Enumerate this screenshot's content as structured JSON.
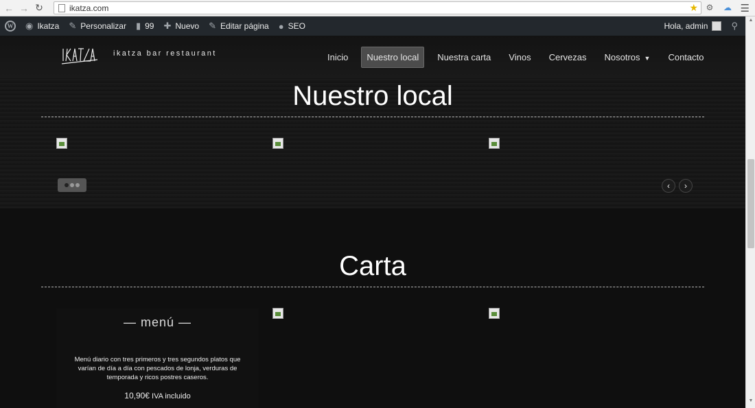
{
  "browser": {
    "url": "ikatza.com",
    "back_icon": "arrow-left-icon",
    "forward_icon": "arrow-right-icon",
    "reload_icon": "reload-icon"
  },
  "adminbar": {
    "site_name": "Ikatza",
    "customize": "Personalizar",
    "comments_count": "99",
    "new": "Nuevo",
    "edit_page": "Editar página",
    "seo": "SEO",
    "greeting": "Hola, admin"
  },
  "header": {
    "logo_text": "IKATZA",
    "tagline": "ikatza bar restaurant",
    "nav": [
      {
        "label": "Inicio"
      },
      {
        "label": "Nuestro local"
      },
      {
        "label": "Nuestra carta"
      },
      {
        "label": "Vinos"
      },
      {
        "label": "Cervezas"
      },
      {
        "label": "Nosotros"
      },
      {
        "label": "Contacto"
      }
    ],
    "active_nav": "Nuestro local"
  },
  "sections": {
    "local_title": "Nuestro local",
    "carta_title": "Carta"
  },
  "menu_card": {
    "heading": "— menú —",
    "description": "Menú diario con tres primeros y tres segundos platos que varían de día a día con pescados de lonja, verduras de temporada y ricos postres caseros.",
    "price": "10,90€",
    "price_note": "IVA incluido"
  },
  "slider": {
    "prev_label": "‹",
    "next_label": "›"
  },
  "colors": {
    "admin_bar": "#23282d",
    "background": "#0f0f0f",
    "active_nav": "#4c4c4c"
  }
}
